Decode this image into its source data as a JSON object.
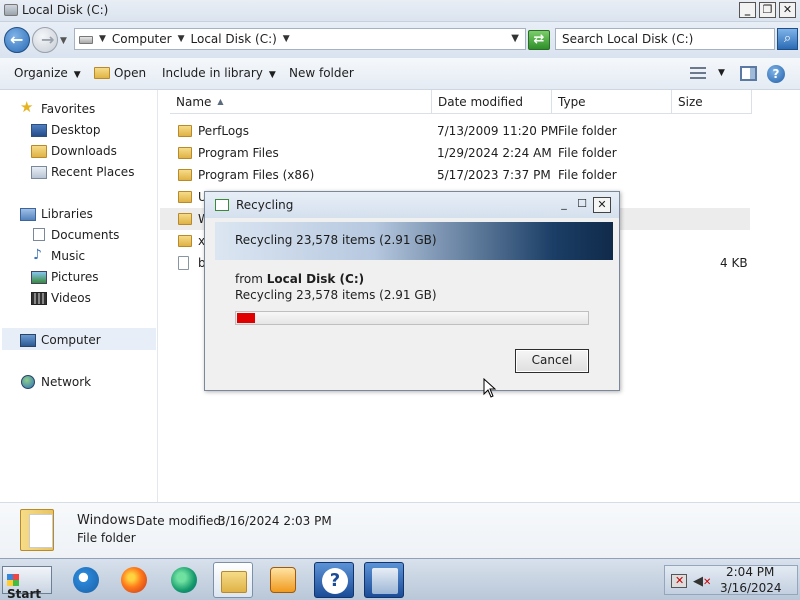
{
  "window": {
    "title": "Local Disk (C:)"
  },
  "address": {
    "crumbs": [
      "Computer",
      "Local Disk (C:)"
    ]
  },
  "search": {
    "placeholder": "Search Local Disk (C:)"
  },
  "toolbar": {
    "organize": "Organize",
    "open": "Open",
    "include": "Include in library",
    "new_folder": "New folder"
  },
  "sidebar": {
    "favorites": "Favorites",
    "desktop": "Desktop",
    "downloads": "Downloads",
    "recent": "Recent Places",
    "libraries": "Libraries",
    "documents": "Documents",
    "music": "Music",
    "pictures": "Pictures",
    "videos": "Videos",
    "computer": "Computer",
    "network": "Network"
  },
  "columns": {
    "name": "Name",
    "date": "Date modified",
    "type": "Type",
    "size": "Size"
  },
  "files": [
    {
      "name": "PerfLogs",
      "date": "7/13/2009 11:20 PM",
      "type": "File folder",
      "size": ""
    },
    {
      "name": "Program Files",
      "date": "1/29/2024 2:24 AM",
      "type": "File folder",
      "size": ""
    },
    {
      "name": "Program Files (x86)",
      "date": "5/17/2023 7:37 PM",
      "type": "File folder",
      "size": ""
    },
    {
      "name": "U",
      "date": "",
      "type": "",
      "size": ""
    },
    {
      "name": "W",
      "date": "",
      "type": "",
      "size": ""
    },
    {
      "name": "x",
      "date": "",
      "type": "",
      "size": ""
    },
    {
      "name": "b",
      "date": "",
      "type": "",
      "size": "4 KB"
    }
  ],
  "details": {
    "name": "Windows",
    "label": "Date modified:",
    "value": "3/16/2024 2:03 PM",
    "type": "File folder"
  },
  "dialog": {
    "title": "Recycling",
    "banner": "Recycling 23,578 items (2.91 GB)",
    "from_prefix": "from",
    "from_location": "Local Disk (C:)",
    "status": "Recycling 23,578 items (2.91 GB)",
    "progress": 0.05,
    "cancel": "Cancel",
    "colors": {
      "progress": "#e00000"
    }
  },
  "taskbar": {
    "start": "Start",
    "time": "2:04 PM",
    "date": "3/16/2024"
  }
}
